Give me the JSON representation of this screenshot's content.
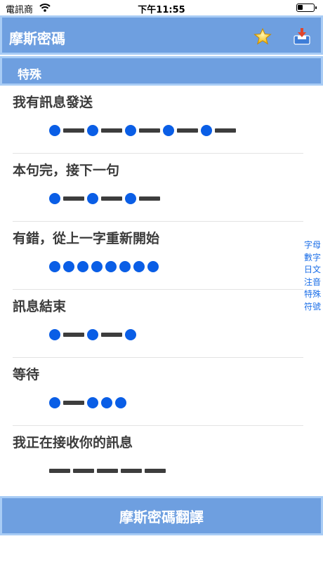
{
  "status_bar": {
    "carrier": "電訊商",
    "time": "下午11:55"
  },
  "header": {
    "title": "摩斯密碼"
  },
  "section": {
    "title": "特殊"
  },
  "items": [
    {
      "title": "我有訊息發送",
      "code": ".-.-.-.-.-"
    },
    {
      "title": "本句完，接下一句",
      "code": ".-.-.-"
    },
    {
      "title": "有錯，從上一字重新開始",
      "code": "........"
    },
    {
      "title": "訊息結束",
      "code": ".-.-."
    },
    {
      "title": "等待",
      "code": ".-..."
    },
    {
      "title": "我正在接收你的訊息",
      "code": "-----"
    }
  ],
  "index": [
    "字母",
    "數字",
    "日文",
    "注音",
    "特殊",
    "符號"
  ],
  "footer": {
    "button_label": "摩斯密碼翻譯"
  },
  "colors": {
    "bar": "#6e9fe0",
    "bar_border": "#a8ccf5",
    "dot": "#0a5ee6",
    "dash": "#3d3d3d",
    "index_text": "#1c6fe8"
  },
  "icons": {
    "favorite": "star-icon",
    "save": "inbox-download-icon",
    "wifi": "wifi-icon",
    "battery": "battery-icon"
  }
}
